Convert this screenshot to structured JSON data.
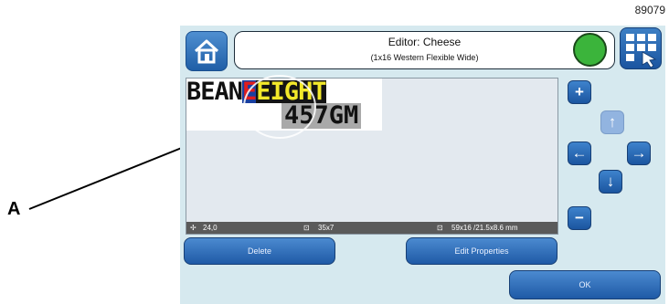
{
  "figure_number": "89079",
  "callout_label": "A",
  "header": {
    "title": "Editor: Cheese",
    "subtitle": "(1x16 Western Flexible Wide)",
    "status_color": "#3bb43b"
  },
  "editor": {
    "line1_a": "BEAN",
    "line1_cursor": "E",
    "line1_b": "EIGHT",
    "line2": "457GM",
    "status": {
      "position": "24,0",
      "field_size": "35x7",
      "message_size": "59x16 /21.5x8.6 mm"
    }
  },
  "buttons": {
    "delete": "Delete",
    "edit_properties": "Edit Properties",
    "ok": "OK",
    "plus": "+",
    "minus": "−",
    "up": "↑",
    "left": "←",
    "right": "→",
    "down": "↓"
  },
  "icons": {
    "home": "home-icon",
    "grid": "keyboard-grid-icon",
    "move": "move-icon",
    "field": "field-size-icon",
    "message": "message-size-icon"
  }
}
